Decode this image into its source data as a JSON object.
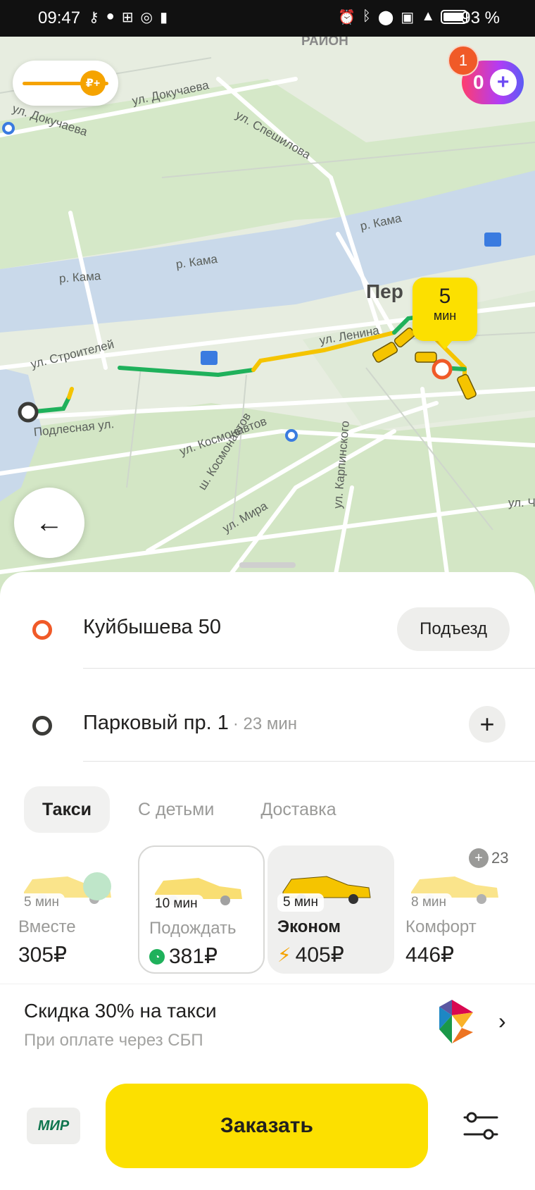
{
  "status_bar": {
    "time": "09:47",
    "left_icons": [
      "key-icon",
      "message-icon",
      "grid-icon",
      "instagram-icon",
      "battery-saver-icon"
    ],
    "right_icons": [
      "alarm-icon",
      "bluetooth-icon",
      "location-icon",
      "volte-icon",
      "signal-icon"
    ],
    "battery": "93 %"
  },
  "map": {
    "district_label": "РАЙОН",
    "city_label": "Пер",
    "streets": [
      "ул. Докучаева",
      "ул. Докучаева",
      "ул. Спешилова",
      "р. Кама",
      "р. Кама",
      "р. Кама",
      "ул. Ленина",
      "ул. Строителей",
      "Подлесная ул.",
      "ул. Космонавтов",
      "ш. Космонавтов",
      "ул. Мира",
      "ул. Карпинского",
      "ул. Ч"
    ],
    "eta": {
      "value": "5",
      "unit": "мин"
    },
    "plus_balance": "0",
    "notifications": "1",
    "tariff_badge_glyph": "₽+"
  },
  "route": {
    "from": {
      "address": "Куйбышева 50",
      "action": "Подъезд"
    },
    "to": {
      "address": "Парковый пр. 1",
      "meta": "· 23 мин",
      "action": "+"
    }
  },
  "tabs": [
    {
      "label": "Такси",
      "active": true
    },
    {
      "label": "С детьми",
      "active": false
    },
    {
      "label": "Доставка",
      "active": false
    }
  ],
  "tariffs": [
    {
      "time": "5 мин",
      "name": "Вместе",
      "price": "305₽",
      "state": "normal"
    },
    {
      "time": "10 мин",
      "name": "Подождать",
      "price": "381₽",
      "state": "selected",
      "icon": "clock-icon"
    },
    {
      "time": "5 мин",
      "name": "Эконом",
      "price": "405₽",
      "state": "current",
      "icon": "lightning-icon"
    },
    {
      "time": "8 мин",
      "name": "Комфорт",
      "price": "446₽",
      "state": "normal"
    }
  ],
  "plus_cashback": "23",
  "promo": {
    "title": "Скидка 30% на такси",
    "subtitle": "При оплате через СБП"
  },
  "footer": {
    "payment": "МИР",
    "order_label": "Заказать"
  },
  "colors": {
    "accent_yellow": "#fce000",
    "route_green": "#1fb15b",
    "origin_orange": "#f05a28"
  }
}
